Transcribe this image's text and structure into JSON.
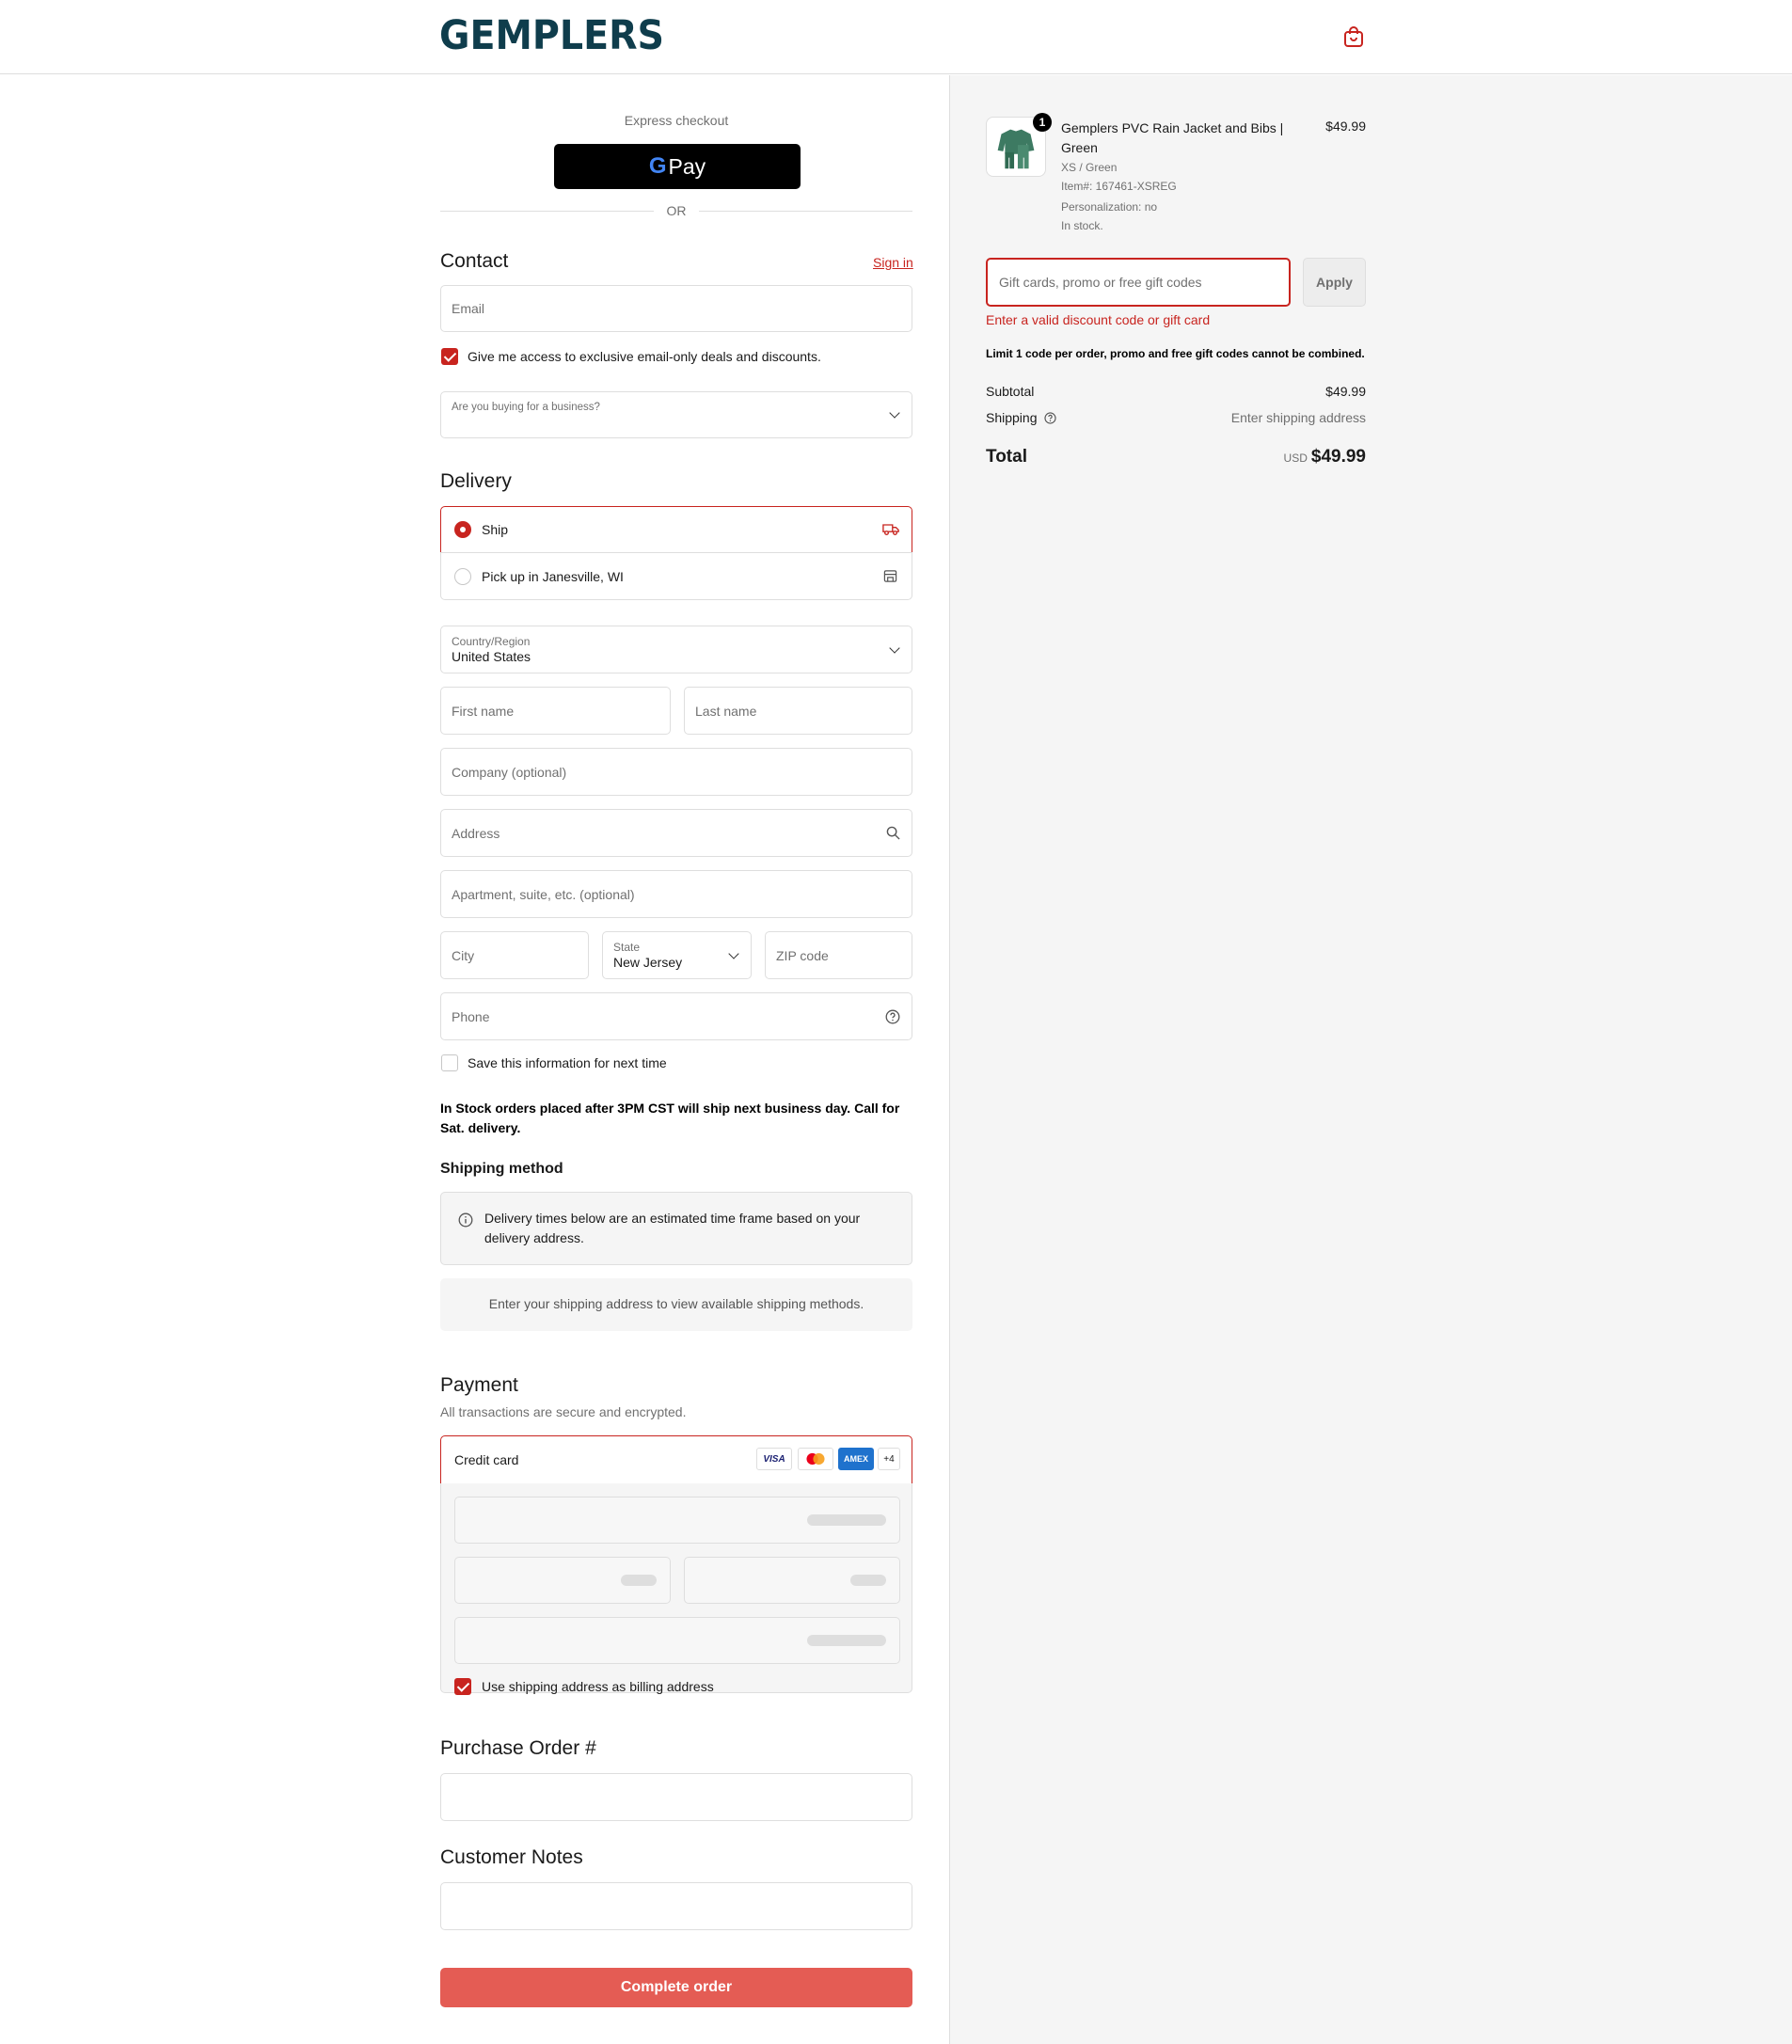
{
  "header": {
    "logo": "GEMPLERS",
    "cart_icon": "shopping-bag-icon"
  },
  "express": {
    "label": "Express checkout",
    "gpay_g": "G",
    "gpay_pay": "Pay",
    "or": "OR"
  },
  "contact": {
    "title": "Contact",
    "sign_in": "Sign in",
    "email_placeholder": "Email",
    "deals_label": "Give me access to exclusive email-only deals and discounts.",
    "deals_checked": true,
    "business_label": "Are you buying for a business?"
  },
  "delivery": {
    "title": "Delivery",
    "ship_label": "Ship",
    "pickup_label": "Pick up in Janesville, WI",
    "selected": "ship",
    "country_label": "Country/Region",
    "country_value": "United States",
    "first_name_placeholder": "First name",
    "last_name_placeholder": "Last name",
    "company_placeholder": "Company (optional)",
    "address_placeholder": "Address",
    "apartment_placeholder": "Apartment, suite, etc. (optional)",
    "city_placeholder": "City",
    "state_label": "State",
    "state_value": "New Jersey",
    "zip_placeholder": "ZIP code",
    "phone_placeholder": "Phone",
    "save_info_label": "Save this information for next time",
    "stock_note": "In Stock orders placed after 3PM CST will ship next business day. Call for Sat. delivery."
  },
  "shipping_method": {
    "title": "Shipping method",
    "info": "Delivery times below are an estimated time frame based on your delivery address.",
    "empty": "Enter your shipping address to view available shipping methods."
  },
  "payment": {
    "title": "Payment",
    "subtitle": "All transactions are secure and encrypted.",
    "credit_card_label": "Credit card",
    "cards": [
      "VISA",
      "MC",
      "AMEX",
      "+4"
    ],
    "billing_label": "Use shipping address as billing address",
    "billing_checked": true
  },
  "purchase_order": {
    "title": "Purchase Order #"
  },
  "customer_notes": {
    "title": "Customer Notes"
  },
  "complete_button": "Complete order",
  "order": {
    "quantity": "1",
    "product_name": "Gemplers PVC Rain Jacket and Bibs | Green",
    "variant": "XS / Green",
    "item_no": "Item#: 167461-XSREG",
    "personalization": "Personalization: no",
    "stock": "In stock.",
    "price": "$49.99",
    "promo_placeholder": "Gift cards, promo or free gift codes",
    "apply": "Apply",
    "promo_error": "Enter a valid discount code or gift card",
    "limit_note": "Limit 1 code per order, promo and free gift codes cannot be combined.",
    "subtotal_label": "Subtotal",
    "subtotal": "$49.99",
    "shipping_label": "Shipping",
    "shipping_value": "Enter shipping address",
    "total_label": "Total",
    "currency": "USD",
    "total": "$49.99"
  },
  "colors": {
    "accent": "#c8241f",
    "button": "#e45c54",
    "brand": "#0f3d4c",
    "sidebar_bg": "#f5f5f5"
  }
}
